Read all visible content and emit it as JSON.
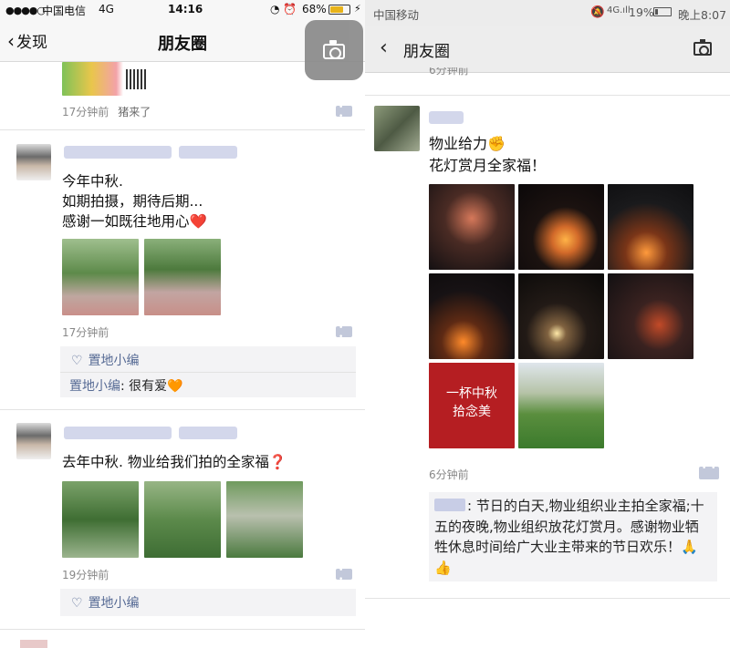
{
  "left": {
    "status": {
      "signal_dots": "●●●●○",
      "carrier": "中国电信",
      "network": "4G",
      "time": "14:16",
      "icons": "◔ ⏰",
      "battery_pct": "68%",
      "battery_level": 0.68,
      "charging": "⚡"
    },
    "nav": {
      "back_label": "发现",
      "title": "朋友圈"
    },
    "post0": {
      "time": "17分钟前",
      "source": "猪来了"
    },
    "post1": {
      "text": [
        "今年中秋.",
        "如期拍摄，期待后期...",
        "感谢一如既往地用心❤️"
      ],
      "time": "17分钟前",
      "liker": "置地小编",
      "comment_name": "置地小编",
      "comment_text": ": 很有爱🧡"
    },
    "post2": {
      "text": "去年中秋. 物业给我们拍的全家福❓",
      "time": "19分钟前",
      "liker": "置地小编"
    }
  },
  "right": {
    "status": {
      "carrier": "中国移动",
      "mute": "🔕",
      "signal": "4G.ıll",
      "battery_pct": "19%",
      "battery_level": 0.19,
      "time": "晚上8:07"
    },
    "nav": {
      "title": "朋友圈"
    },
    "prev_time": "6分钟前",
    "post": {
      "text": [
        "物业给力✊",
        "花灯赏月全家福！"
      ],
      "time": "6分钟前",
      "poster_text": [
        "一杯中秋",
        "拾念美"
      ],
      "comment": ": 节日的白天,物业组织业主拍全家福;十五的夜晚,物业组织放花灯赏月。感谢物业牺牲休息时间给广大业主带来的节日欢乐！🙏👍"
    }
  },
  "colors": {
    "link_blue": "#576b95",
    "battery_yellow": "#e8b31a"
  }
}
